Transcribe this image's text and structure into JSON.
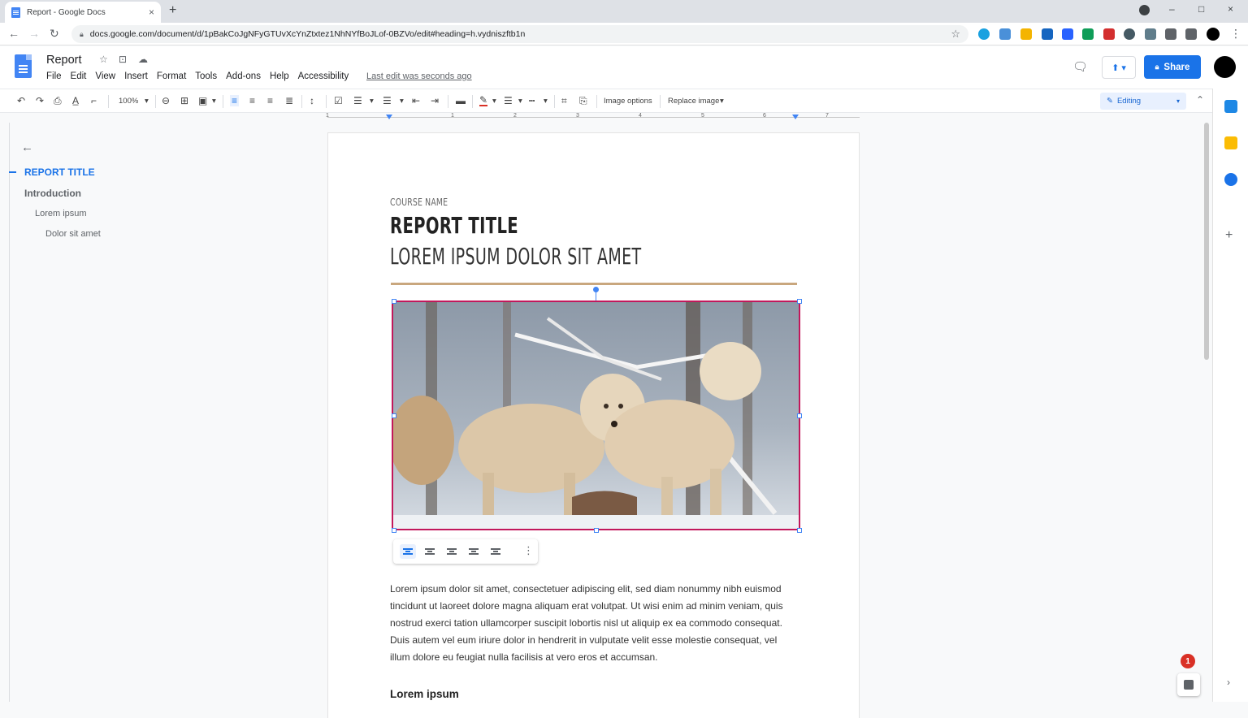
{
  "browser": {
    "tab_title": "Report - Google Docs",
    "tab_close": "×",
    "new_tab": "+",
    "url": "docs.google.com/document/d/1pBakCoJgNFyGTUvXcYnZtxtez1NhNYfBoJLof-0BZVo/edit#heading=h.vydniszftb1n",
    "window_controls": [
      "–",
      "□",
      "×"
    ]
  },
  "docs": {
    "title": "Report",
    "menu": [
      "File",
      "Edit",
      "View",
      "Insert",
      "Format",
      "Tools",
      "Add-ons",
      "Help",
      "Accessibility"
    ],
    "last_edit": "Last edit was seconds ago",
    "share_label": "Share",
    "zoom": "100%",
    "image_options_label": "Image options",
    "replace_image_label": "Replace image",
    "editing_mode": "Editing"
  },
  "ruler": {
    "numbers": [
      "1",
      "1",
      "2",
      "3",
      "4",
      "5",
      "6",
      "7"
    ]
  },
  "outline": {
    "items": [
      {
        "label": "REPORT TITLE",
        "level": 1
      },
      {
        "label": "Introduction",
        "level": 2
      },
      {
        "label": "Lorem ipsum",
        "level": 3
      },
      {
        "label": "Dolor sit amet",
        "level": 4
      }
    ]
  },
  "document": {
    "course_name": "COURSE NAME",
    "report_title": "REPORT TITLE",
    "subtitle": "LOREM IPSUM DOLOR SIT AMET",
    "body": "Lorem ipsum dolor sit amet, consectetuer adipiscing elit, sed diam nonummy nibh euismod tincidunt ut laoreet dolore magna aliquam erat volutpat. Ut wisi enim ad minim veniam, quis nostrud exerci tation ullamcorper suscipit lobortis nisl ut aliquip ex ea commodo consequat. Duis autem vel eum iriure dolor in hendrerit in vulputate velit esse molestie consequat, vel illum dolore eu feugiat nulla facilisis at vero eros et accumsan.",
    "section_heading": "Lorem ipsum"
  },
  "notifications": {
    "count": "1"
  },
  "colors": {
    "accent": "#1a73e8",
    "title_rule": "#c9a77e",
    "image_border": "#c2185b",
    "badge": "#d93025"
  },
  "icons": {
    "toolbar": [
      "undo-icon",
      "redo-icon",
      "print-icon",
      "spellcheck-icon",
      "paint-format-icon",
      "link-icon",
      "comment-add-icon",
      "image-icon",
      "align-left-icon",
      "align-center-icon",
      "align-right-icon",
      "justify-icon",
      "line-spacing-icon",
      "checklist-icon",
      "bulleted-list-icon",
      "numbered-list-icon",
      "indent-decrease-icon",
      "indent-increase-icon",
      "border-icon",
      "border-color-icon",
      "border-weight-icon",
      "border-dash-icon",
      "crop-icon",
      "reset-image-icon"
    ]
  }
}
